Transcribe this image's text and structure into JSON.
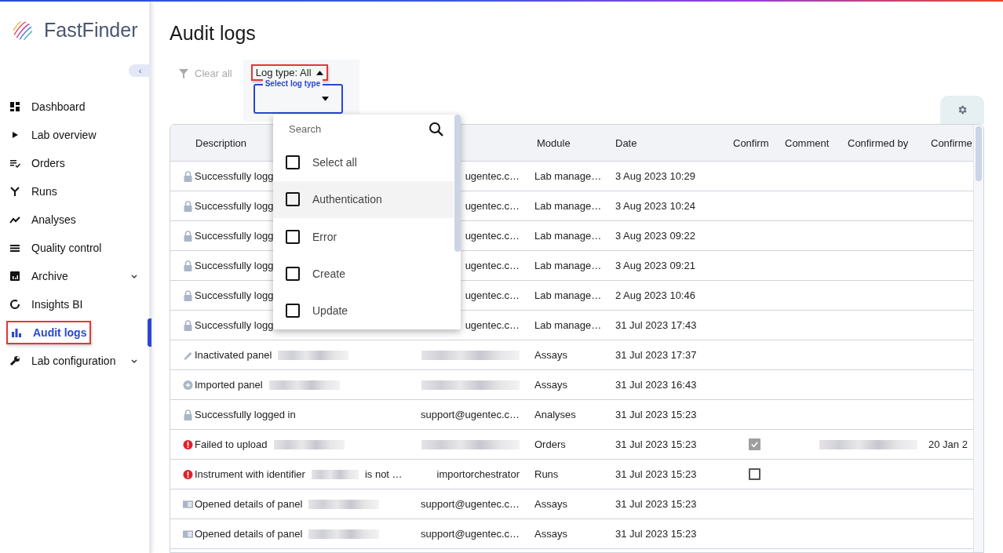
{
  "app": {
    "name": "FastFinder"
  },
  "collapse": {
    "label": "‹"
  },
  "sidebar": {
    "items": [
      {
        "label": "Dashboard",
        "selected": false
      },
      {
        "label": "Lab overview",
        "selected": false
      },
      {
        "label": "Orders",
        "selected": false
      },
      {
        "label": "Runs",
        "selected": false
      },
      {
        "label": "Analyses",
        "selected": false
      },
      {
        "label": "Quality control",
        "selected": false
      },
      {
        "label": "Archive",
        "selected": false,
        "expanded": false
      },
      {
        "label": "Insights BI",
        "selected": false
      },
      {
        "label": "Audit logs",
        "selected": true
      },
      {
        "label": "Lab configuration",
        "selected": false,
        "expanded": false
      }
    ]
  },
  "page": {
    "title": "Audit logs"
  },
  "filters": {
    "clear_all": {
      "label": "Clear all",
      "disabled": true
    },
    "log_type": {
      "label": "Log type:",
      "value": "All",
      "expanded": true
    },
    "select": {
      "label": "Select log type"
    },
    "dropdown": {
      "placeholder": "Search",
      "options": [
        {
          "label": "Select all",
          "checked": false,
          "hovered": false
        },
        {
          "label": "Authentication",
          "checked": false,
          "hovered": true
        },
        {
          "label": "Error",
          "checked": false,
          "hovered": false
        },
        {
          "label": "Create",
          "checked": false,
          "hovered": false
        },
        {
          "label": "Update",
          "checked": false,
          "hovered": false
        }
      ]
    }
  },
  "table": {
    "columns": [
      "Description",
      "",
      "Module",
      "Date",
      "Confirm",
      "Comment",
      "Confirmed by",
      "Confirme"
    ],
    "rows": [
      {
        "kind": "lock",
        "description": "Successfully logg",
        "user": "ugentec.c…",
        "module": "Lab manage…",
        "date": "3 Aug 2023 10:29"
      },
      {
        "kind": "lock",
        "description": "Successfully logg",
        "user": "ugentec.c…",
        "module": "Lab manage…",
        "date": "3 Aug 2023 10:24"
      },
      {
        "kind": "lock",
        "description": "Successfully logg",
        "user": "ugentec.c…",
        "module": "Lab manage…",
        "date": "3 Aug 2023 09:22"
      },
      {
        "kind": "lock",
        "description": "Successfully logg",
        "user": "ugentec.c…",
        "module": "Lab manage…",
        "date": "3 Aug 2023 09:21"
      },
      {
        "kind": "lock",
        "description": "Successfully logg",
        "user": "ugentec.c…",
        "module": "Lab manage…",
        "date": "2 Aug 2023 10:46"
      },
      {
        "kind": "lock",
        "description": "Successfully logg",
        "user": "ugentec.c…",
        "module": "Lab manage…",
        "date": "31 Jul 2023 17:43"
      },
      {
        "kind": "pencil",
        "description": "Inactivated panel",
        "redacted": true,
        "user_redacted": true,
        "module": "Assays",
        "date": "31 Jul 2023 17:37"
      },
      {
        "kind": "plus",
        "description": "Imported panel",
        "redacted": true,
        "user_redacted": true,
        "module": "Assays",
        "date": "31 Jul 2023 16:43"
      },
      {
        "kind": "lock",
        "description": "Successfully logged in",
        "user": "support@ugentec.c…",
        "module": "Analyses",
        "date": "31 Jul 2023 15:23"
      },
      {
        "kind": "error",
        "description": "Failed to upload",
        "redacted": true,
        "user_redacted": true,
        "module": "Orders",
        "date": "31 Jul 2023 15:23",
        "confirmed": true,
        "confirmed_by_redacted": true,
        "confirmed_on": "20 Jan 2"
      },
      {
        "kind": "error",
        "description": "Instrument with identifier",
        "redacted": true,
        "description_end": "is not …",
        "user": "importorchestrator",
        "module": "Runs",
        "date": "31 Jul 2023 15:23",
        "confirmed": false
      },
      {
        "kind": "panel",
        "description": "Opened details of panel",
        "redacted": true,
        "user": "support@ugentec.c…",
        "module": "Assays",
        "date": "31 Jul 2023 15:23"
      },
      {
        "kind": "panel",
        "description": "Opened details of panel",
        "redacted": true,
        "user": "support@ugentec.c…",
        "module": "Assays",
        "date": "31 Jul 2023 15:23"
      }
    ]
  }
}
